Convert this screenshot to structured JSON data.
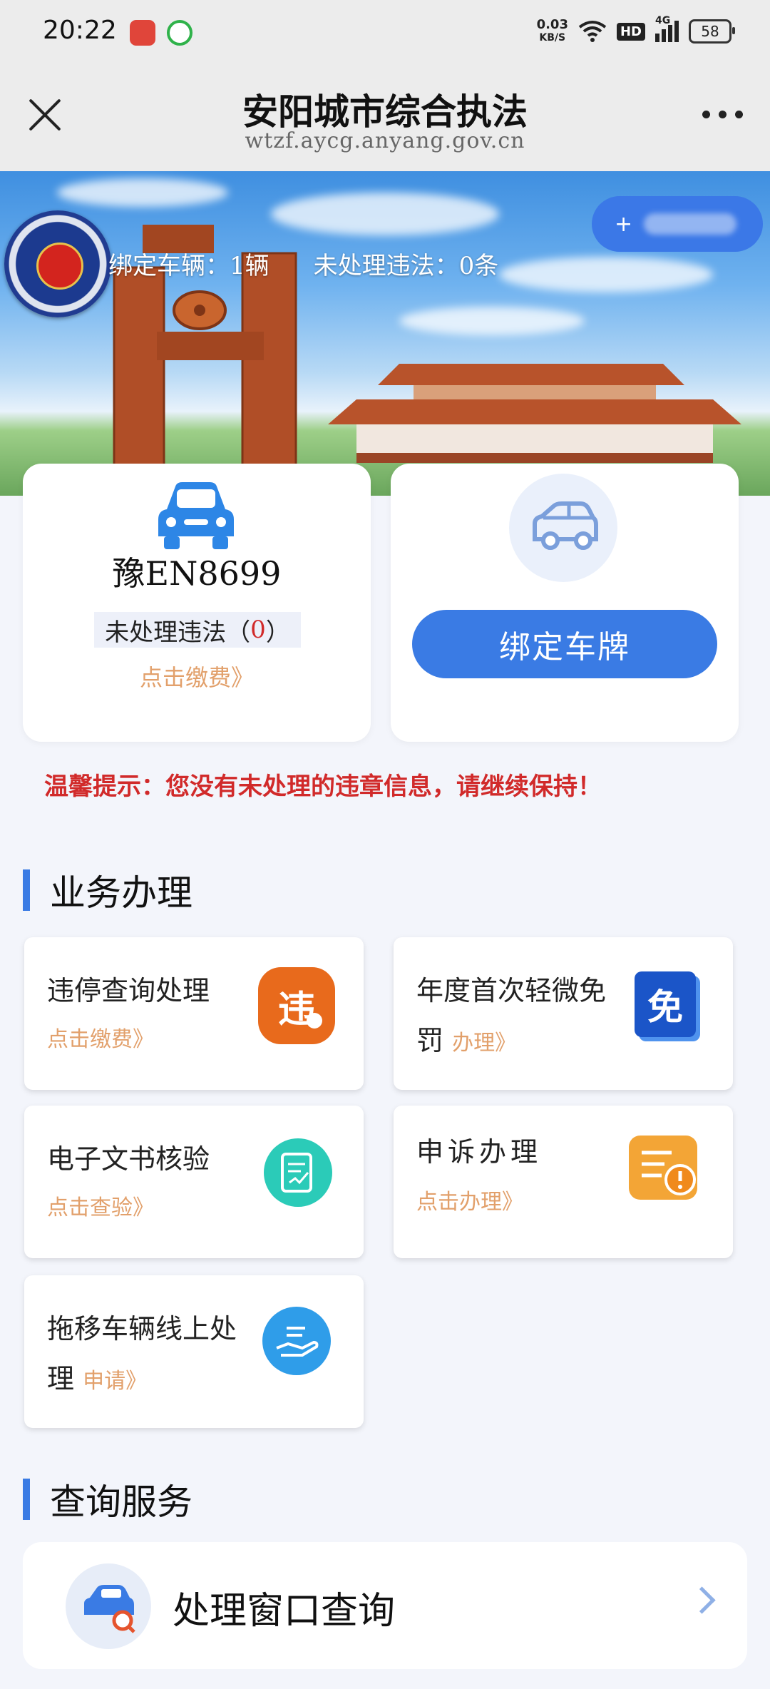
{
  "status_bar": {
    "time": "20:22",
    "net_speed_value": "0.03",
    "net_speed_unit": "KB/S",
    "hd": "HD",
    "signal": "4G",
    "battery": "58"
  },
  "header": {
    "title": "安阳城市综合执法",
    "url": "wtzf.aycg.anyang.gov.cn"
  },
  "banner": {
    "bound_vehicles": "绑定车辆：1辆",
    "unprocessed": "未处理违法：0条",
    "add_button_plus": "+"
  },
  "vehicle_card": {
    "plate": "豫EN8699",
    "violation_label": "未处理违法（",
    "violation_count": "0",
    "violation_close": "）",
    "pay_link": "点击缴费》"
  },
  "bind_card": {
    "button_label": "绑定车牌"
  },
  "tip": "温馨提示：您没有未处理的违章信息，请继续保持！",
  "business": {
    "section_title": "业务办理",
    "items": [
      {
        "title": "违停查询处理",
        "link": "点击缴费》"
      },
      {
        "title_line1": "年度首次轻微免",
        "title_line2": "罚",
        "link": "办理》"
      },
      {
        "title": "电子文书核验",
        "link": "点击查验》"
      },
      {
        "title": "申诉办理",
        "link": "点击办理》"
      },
      {
        "title_line1": "拖移车辆线上处",
        "title_line2": "理",
        "link": "申请》"
      }
    ],
    "icon_text_violation": "违",
    "icon_text_exempt": "免"
  },
  "query": {
    "section_title": "查询服务",
    "item_label": "处理窗口查询"
  },
  "colors": {
    "accent": "#3a7be4",
    "warning": "#d12a2a",
    "link": "#e2a06b"
  }
}
